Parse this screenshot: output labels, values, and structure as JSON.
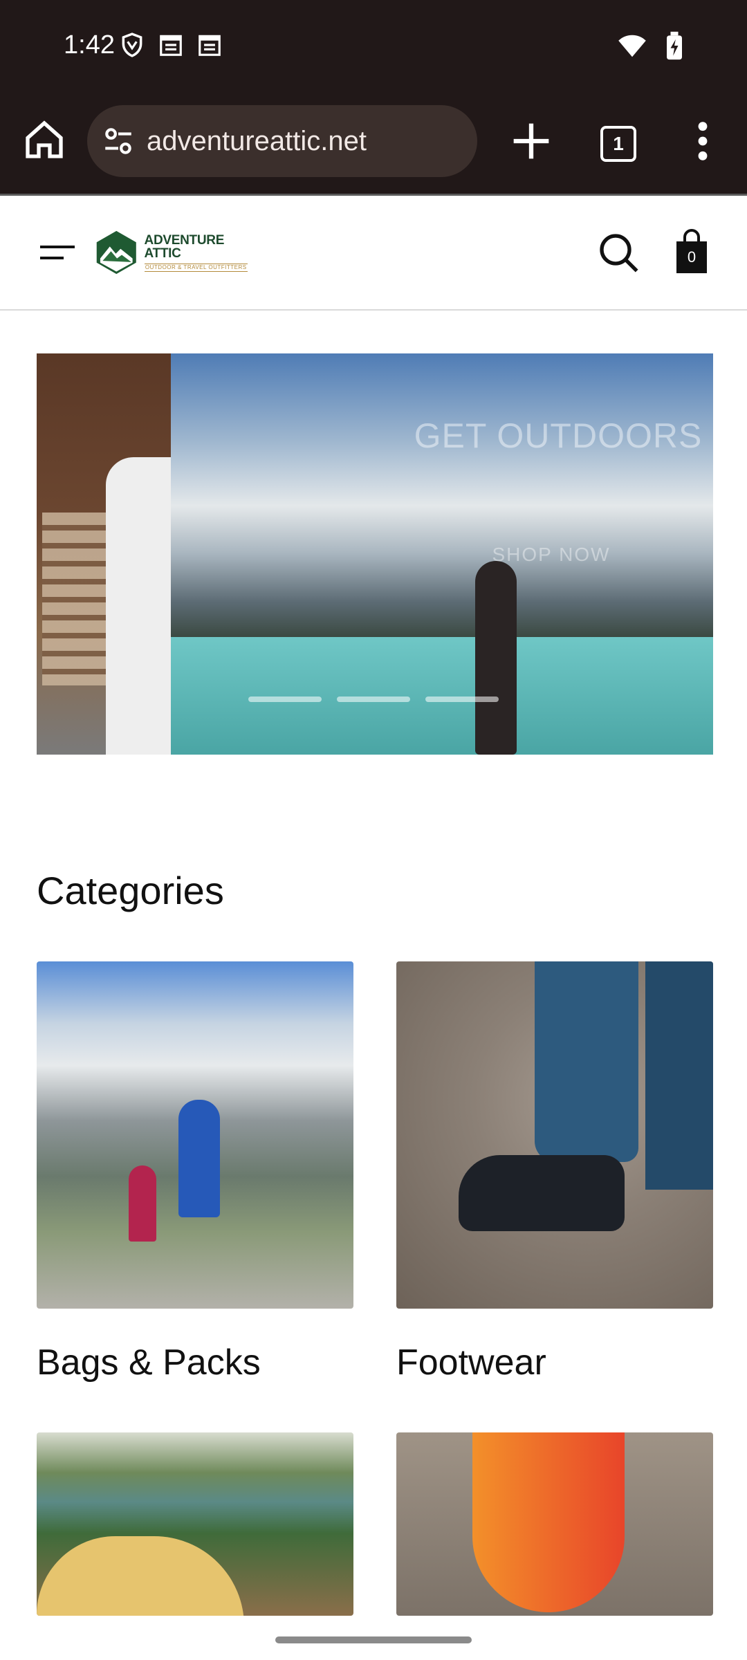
{
  "status": {
    "time": "1:42",
    "icons_left": [
      "vpn-shield-icon",
      "calendar-icon",
      "calendar-icon"
    ],
    "icons_right": [
      "wifi-icon",
      "battery-charging-icon"
    ]
  },
  "browser": {
    "url": "adventureattic.net",
    "tab_count": "1"
  },
  "site": {
    "logo_title": "ADVENTURE ATTIC",
    "logo_subtitle": "OUTDOOR & TRAVEL OUTFITTERS",
    "cart_count": "0"
  },
  "hero": {
    "headline": "GET OUTDOORS",
    "cta": "SHOP NOW",
    "slide_count": 3
  },
  "categories": {
    "title": "Categories",
    "items": [
      {
        "label": "Bags & Packs"
      },
      {
        "label": "Footwear"
      },
      {
        "label": ""
      },
      {
        "label": ""
      }
    ]
  }
}
